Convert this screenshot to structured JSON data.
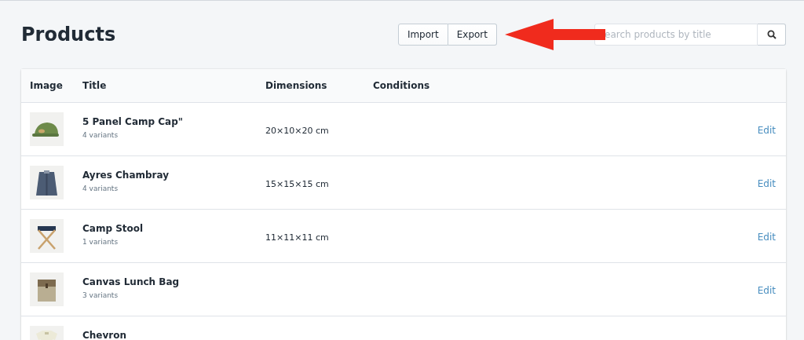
{
  "page": {
    "title": "Products"
  },
  "actions": [
    "Import",
    "Export"
  ],
  "search": {
    "placeholder": "earch products by title"
  },
  "table": {
    "columns": [
      "Image",
      "Title",
      "Dimensions",
      "Conditions"
    ],
    "rows": [
      {
        "title": "5 Panel Camp Cap\"",
        "variants": "4 variants",
        "dimensions": "20×10×20 cm",
        "action": "Edit"
      },
      {
        "title": "Ayres Chambray",
        "variants": "4 variants",
        "dimensions": "15×15×15 cm",
        "action": "Edit"
      },
      {
        "title": "Camp Stool",
        "variants": "1 variants",
        "dimensions": "11×11×11 cm",
        "action": "Edit"
      },
      {
        "title": "Canvas Lunch Bag",
        "variants": "3 variants",
        "action": "Edit"
      },
      {
        "title": "Chevron"
      }
    ]
  }
}
